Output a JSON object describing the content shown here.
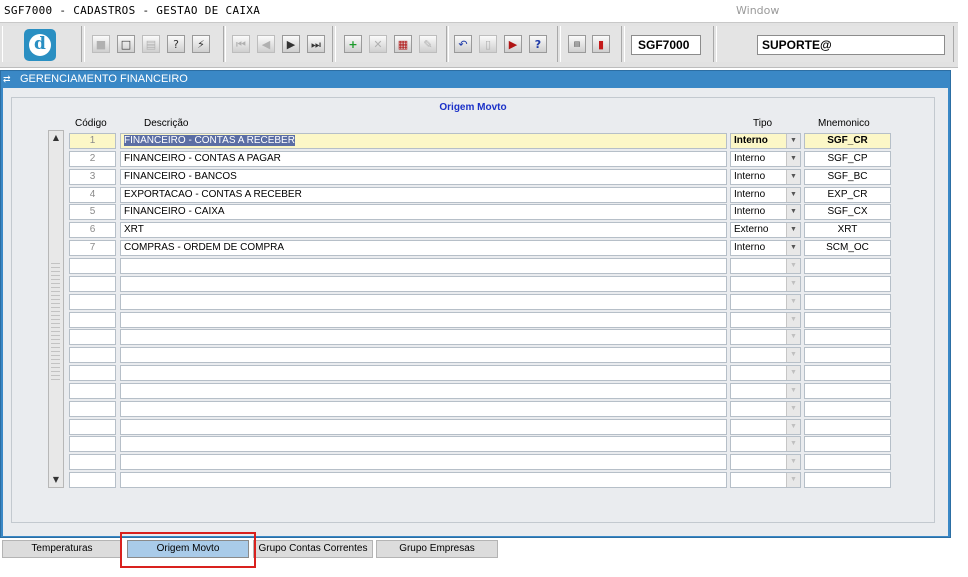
{
  "app": {
    "title": "SGF7000 - CADASTROS - GESTAO DE CAIXA",
    "window_menu": "Window"
  },
  "toolbar": {
    "logo_letter": "d",
    "form_code": "SGF7000",
    "user": "SUPORTE@",
    "icons": [
      "save-icon",
      "print-preview-icon",
      "print-icon",
      "help-query-icon",
      "execute-query-icon",
      "first-record-icon",
      "previous-record-icon",
      "next-record-icon",
      "last-record-icon",
      "insert-record-icon",
      "delete-record-icon",
      "list-values-icon",
      "clear-icon",
      "undo-icon",
      "clipboard-icon",
      "exit-form-icon",
      "help-icon",
      "menu-icon",
      "exit-icon"
    ]
  },
  "window": {
    "title": "GERENCIAMENTO FINANCEIRO",
    "title_color": "#3a88c6"
  },
  "block": {
    "title": "Origem Movto",
    "columns": {
      "codigo": "Código",
      "descricao": "Descrição",
      "tipo": "Tipo",
      "mnemonico": "Mnemonico"
    },
    "rows": [
      {
        "codigo": "1",
        "descricao": "FINANCEIRO - CONTAS A RECEBER",
        "tipo": "Interno",
        "mnemonico": "SGF_CR"
      },
      {
        "codigo": "2",
        "descricao": "FINANCEIRO - CONTAS A PAGAR",
        "tipo": "Interno",
        "mnemonico": "SGF_CP"
      },
      {
        "codigo": "3",
        "descricao": "FINANCEIRO - BANCOS",
        "tipo": "Interno",
        "mnemonico": "SGF_BC"
      },
      {
        "codigo": "4",
        "descricao": "EXPORTACAO - CONTAS A RECEBER",
        "tipo": "Interno",
        "mnemonico": "EXP_CR"
      },
      {
        "codigo": "5",
        "descricao": "FINANCEIRO - CAIXA",
        "tipo": "Interno",
        "mnemonico": "SGF_CX"
      },
      {
        "codigo": "6",
        "descricao": "XRT",
        "tipo": "Externo",
        "mnemonico": "XRT"
      },
      {
        "codigo": "7",
        "descricao": "COMPRAS - ORDEM DE COMPRA",
        "tipo": "Interno",
        "mnemonico": "SCM_OC"
      }
    ],
    "empty_rows": 13,
    "current_row_color": "#fcf7c7"
  },
  "tabs": [
    {
      "label": "Temperaturas",
      "active": false
    },
    {
      "label": "Origem Movto",
      "active": true
    },
    {
      "label": "Grupo Contas Correntes",
      "active": false
    },
    {
      "label": "Grupo Empresas",
      "active": false
    }
  ],
  "annotation_color": "#d9211e"
}
